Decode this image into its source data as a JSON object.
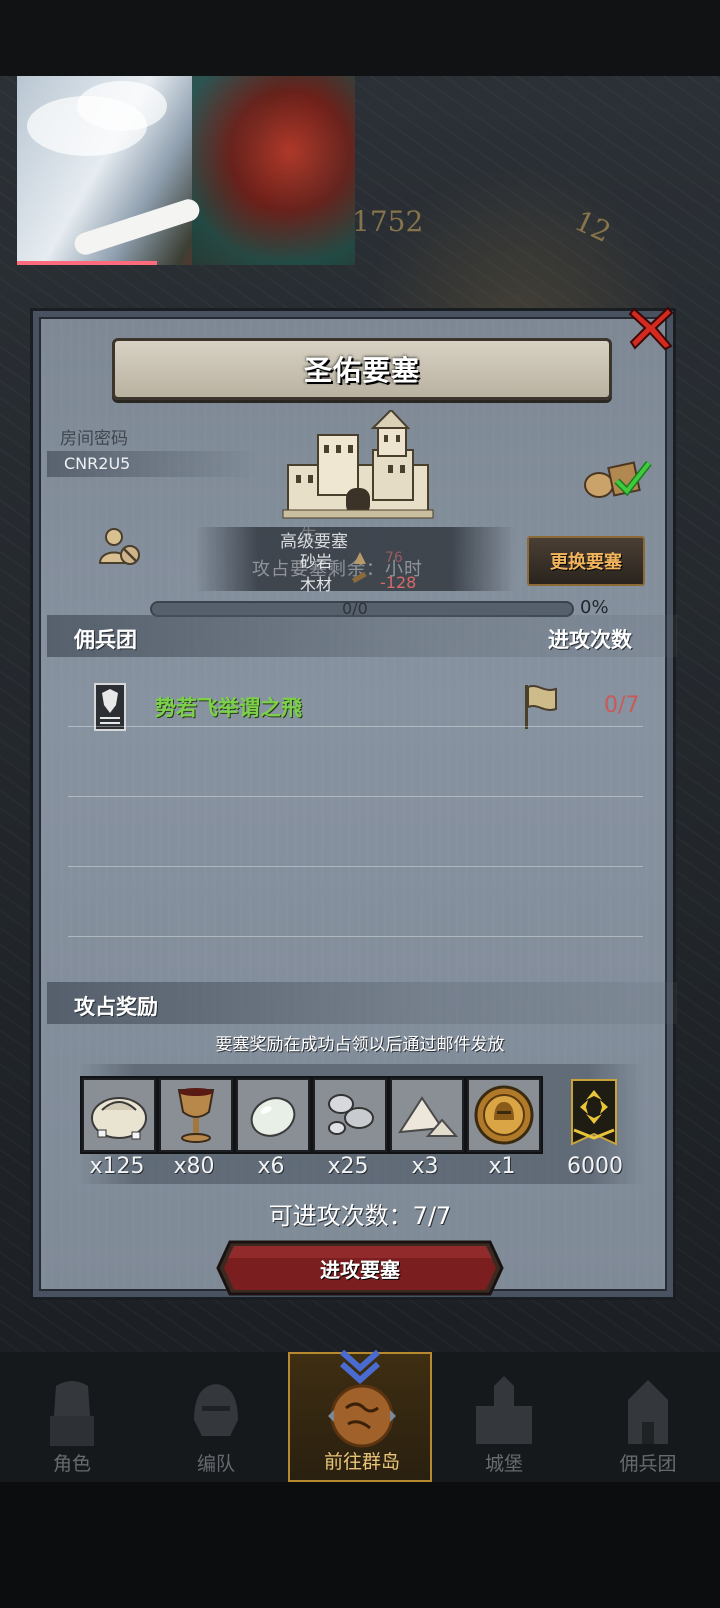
{
  "background": {
    "map_numbers": [
      "1752",
      "12"
    ]
  },
  "fortress": {
    "title": "圣佑要塞",
    "room_label": "房间密码",
    "room_code": "CNR2U5",
    "level": "高级要塞",
    "overlay_faded": "生",
    "occupy_text": "攻占要塞剩余：小时",
    "resources": [
      {
        "name": "砂岩",
        "value": "76"
      },
      {
        "name": "木材",
        "value": "-128"
      }
    ],
    "change_button": "更换要塞",
    "progress": {
      "text": "0/0",
      "percent_label": "0%",
      "value": 0
    }
  },
  "mercenary": {
    "header_left": "佣兵团",
    "header_right": "进攻次数",
    "rows": [
      {
        "guild_name": "势若飞举谓之飛",
        "attack_count": "0/7"
      }
    ]
  },
  "rewards": {
    "header": "攻占奖励",
    "note": "要塞奖励在成功占领以后通过邮件发放",
    "items": [
      {
        "icon": "silver-sack-icon",
        "count": "x125"
      },
      {
        "icon": "goblet-icon",
        "count": "x80"
      },
      {
        "icon": "pearl-icon",
        "count": "x6"
      },
      {
        "icon": "silver-ore-icon",
        "count": "x25"
      },
      {
        "icon": "salt-pile-icon",
        "count": "x3"
      },
      {
        "icon": "knight-medal-icon",
        "count": "x1"
      },
      {
        "icon": "rank-banner-icon",
        "count": "6000"
      }
    ]
  },
  "attempts_label": "可进攻次数：7/7",
  "attack_button": "进攻要塞",
  "nav": {
    "items": [
      {
        "label": "角色",
        "icon": "knight-bust-icon"
      },
      {
        "label": "编队",
        "icon": "helmet-icon"
      },
      {
        "label": "前往群岛",
        "icon": "island-globe-icon",
        "active": true
      },
      {
        "label": "城堡",
        "icon": "castle-icon"
      },
      {
        "label": "佣兵团",
        "icon": "mercenary-castle-icon"
      }
    ]
  },
  "colors": {
    "accent_gold": "#e7c47a",
    "close_red": "#d42a20",
    "guild_green": "#7bd14a",
    "count_red": "#c85a5a",
    "attack_button_red": "#7a1e20"
  }
}
